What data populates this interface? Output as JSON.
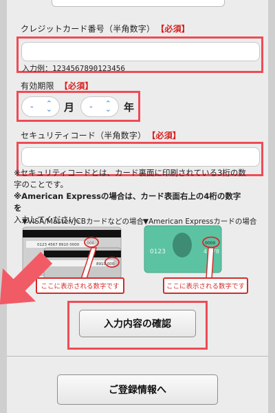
{
  "card_number": {
    "label": "クレジットカード番号（半角数字）",
    "required": "【必須】",
    "value": "",
    "example": "入力例：1234567890123456"
  },
  "expiry": {
    "label": "有効期限",
    "required": "【必須】",
    "month_value": "-",
    "month_unit": "月",
    "year_value": "-",
    "year_unit": "年"
  },
  "security_code": {
    "label": "セキュリティコード（半角数字）",
    "required": "【必須】",
    "value": ""
  },
  "note": {
    "line1": "※セキュリティコードとは、カード裏面に印刷されている3桁の数",
    "line2": "字のことです。",
    "line3": "※American Expressの場合は、カード表面右上の4桁の数字を",
    "line4": "入力してください。"
  },
  "guide": {
    "visa_caption": "▼VISA/Master/JCBカードなどの場合",
    "amex_caption": "▼American Expressカードの場合",
    "visa_card_back_number": "0123 4567 8910 0000",
    "visa_code": "000",
    "visa_card2_number": "8910 000",
    "amex_left": "0123",
    "amex_right": "45 78",
    "amex_code": "0000",
    "visa_bubble": "ここに表示される数字です",
    "amex_bubble": "ここに表示される数字です"
  },
  "buttons": {
    "confirm": "入力内容の確認",
    "register": "ご登録情報へ"
  },
  "colors": {
    "highlight": "#ee4b55",
    "required": "#d81e1e",
    "select_accent": "#3a85d6"
  }
}
